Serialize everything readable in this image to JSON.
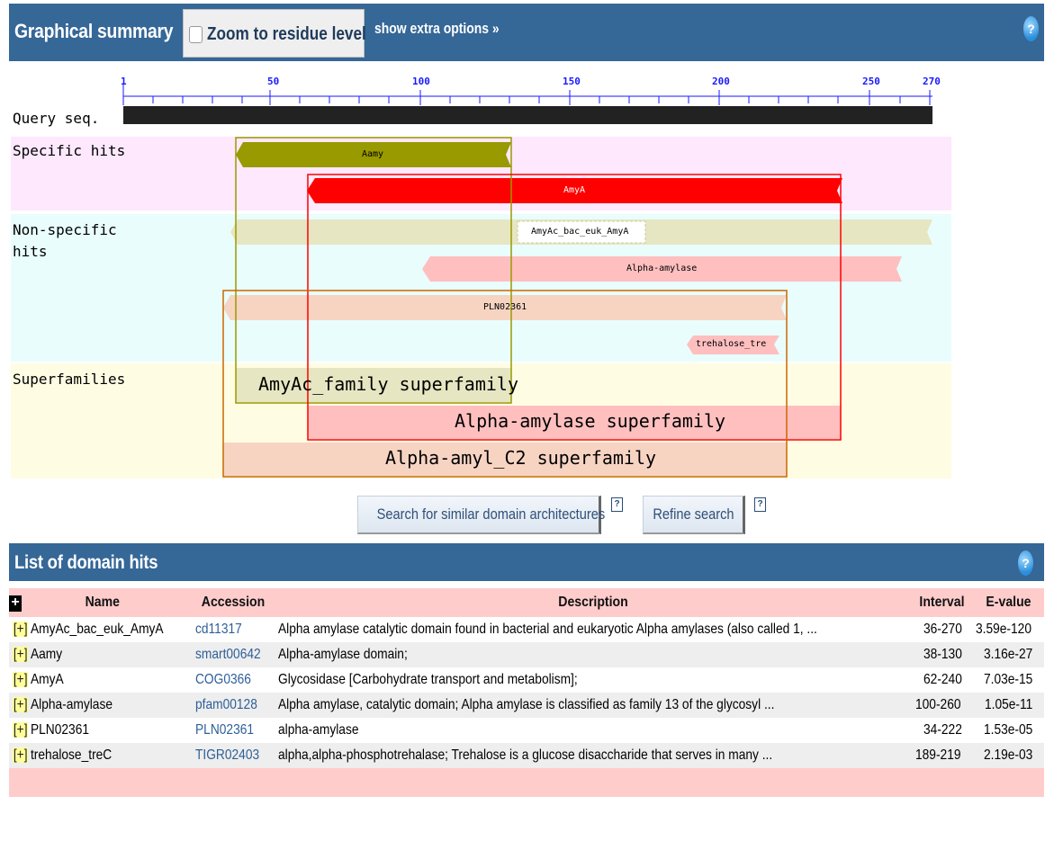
{
  "graphical_summary": {
    "title": "Graphical summary",
    "zoom_label": "Zoom to residue level",
    "zoom_checked": false,
    "extra_options": "show extra options »",
    "help": "?"
  },
  "ruler": {
    "ticks": [
      "1",
      "50",
      "100",
      "150",
      "200",
      "250",
      "270"
    ]
  },
  "row_labels": {
    "query": "Query seq.",
    "specific": "Specific hits",
    "nonspecific_1": "Non-specific",
    "nonspecific_2": "hits",
    "superfamilies": "Superfamilies"
  },
  "hit_labels": {
    "aamy": "Aamy",
    "amya": "AmyA",
    "amyac": "AmyAc_bac_euk_AmyA",
    "alpha_amylase": "Alpha-amylase",
    "pln02361": "PLN02361",
    "trehalose": "trehalose_tre"
  },
  "superfamilies": {
    "amyac": "AmyAc_family superfamily",
    "alpha_amylase": "Alpha-amylase superfamily",
    "alpha_amyl_c2": "Alpha-amyl_C2 superfamily"
  },
  "buttons": {
    "search_similar": "Search for similar domain architectures",
    "refine": "Refine search",
    "help": "?"
  },
  "colors": {
    "header_bar": "#356797",
    "specific_band": "#fde8fd",
    "nonspecific_band": "#e9fdfd",
    "superfamily_band": "#fefde3",
    "aamy": "#999900",
    "amya": "#ff0000",
    "amyac": "#e6e6c2",
    "alpha_amylase": "#ffbfbf",
    "pln02361": "#f7d4c2",
    "table_header": "#ffcccc"
  },
  "domain_hits": {
    "title": "List of domain hits",
    "help": "?",
    "expand_all": "+",
    "columns": [
      "Name",
      "Accession",
      "Description",
      "Interval",
      "E-value"
    ],
    "rows": [
      {
        "name": "AmyAc_bac_euk_AmyA",
        "accession": "cd11317",
        "description": "Alpha amylase catalytic domain found in bacterial and eukaryotic Alpha amylases (also called 1, ...",
        "interval": "36-270",
        "evalue": "3.59e-120"
      },
      {
        "name": "Aamy",
        "accession": "smart00642",
        "description": "Alpha-amylase domain;",
        "interval": "38-130",
        "evalue": "3.16e-27"
      },
      {
        "name": "AmyA",
        "accession": "COG0366",
        "description": "Glycosidase [Carbohydrate transport and metabolism];",
        "interval": "62-240",
        "evalue": "7.03e-15"
      },
      {
        "name": "Alpha-amylase",
        "accession": "pfam00128",
        "description": "Alpha amylase, catalytic domain; Alpha amylase is classified as family 13 of the glycosyl ...",
        "interval": "100-260",
        "evalue": "1.05e-11"
      },
      {
        "name": "PLN02361",
        "accession": "PLN02361",
        "description": "alpha-amylase",
        "interval": "34-222",
        "evalue": "1.53e-05"
      },
      {
        "name": "trehalose_treC",
        "accession": "TIGR02403",
        "description": "alpha,alpha-phosphotrehalase; Trehalose is a glucose disaccharide that serves in many ...",
        "interval": "189-219",
        "evalue": "2.19e-03"
      }
    ],
    "row_expand": "[+]"
  }
}
